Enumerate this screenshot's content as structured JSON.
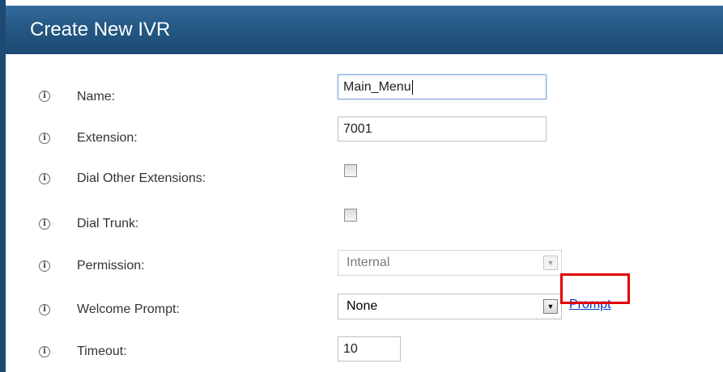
{
  "header": {
    "title": "Create New IVR"
  },
  "fields": {
    "name": {
      "label": "Name:",
      "value": "Main_Menu"
    },
    "extension": {
      "label": "Extension:",
      "value": "7001"
    },
    "dial_other_extensions": {
      "label": "Dial Other Extensions:",
      "checked": false
    },
    "dial_trunk": {
      "label": "Dial Trunk:",
      "checked": false
    },
    "permission": {
      "label": "Permission:",
      "value": "Internal"
    },
    "welcome_prompt": {
      "label": "Welcome Prompt:",
      "value": "None",
      "link": "Prompt"
    },
    "timeout": {
      "label": "Timeout:",
      "value": "10"
    }
  },
  "icons": {
    "info": "info-icon"
  },
  "colors": {
    "header": "#245883",
    "link": "#0033cc",
    "highlight": "#e00000"
  }
}
